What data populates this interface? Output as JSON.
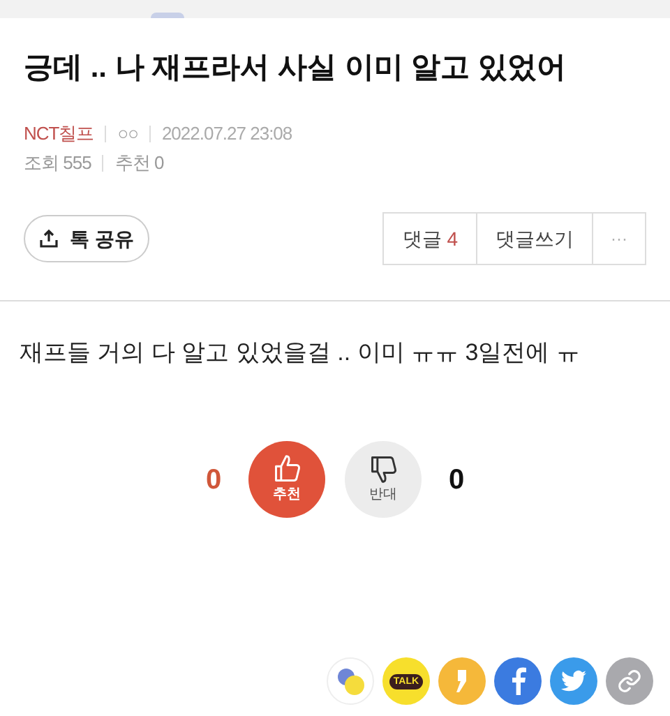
{
  "title": "긍데 .. 나 재프라서 사실 이미 알고 있었어",
  "meta": {
    "author": "NCT칠프",
    "grade": "○○",
    "date": "2022.07.27 23:08",
    "views_label": "조회",
    "views": "555",
    "recommend_label": "추천",
    "recommend": "0"
  },
  "share_button": {
    "label": "톡 공유"
  },
  "comment_buttons": {
    "comments_label": "댓글",
    "comments_count": "4",
    "write_label": "댓글쓰기",
    "more": "···"
  },
  "body": "재프들 거의 다 알고 있었을걸 .. 이미 ㅠㅠ 3일전에 ㅠ",
  "votes": {
    "up_count": "0",
    "up_label": "추천",
    "down_label": "반대",
    "down_count": "0"
  },
  "share_icons": [
    {
      "kind": "circles"
    },
    {
      "kind": "talk",
      "label": "TALK"
    },
    {
      "kind": "comma"
    },
    {
      "kind": "facebook"
    },
    {
      "kind": "bird"
    },
    {
      "kind": "link"
    }
  ]
}
